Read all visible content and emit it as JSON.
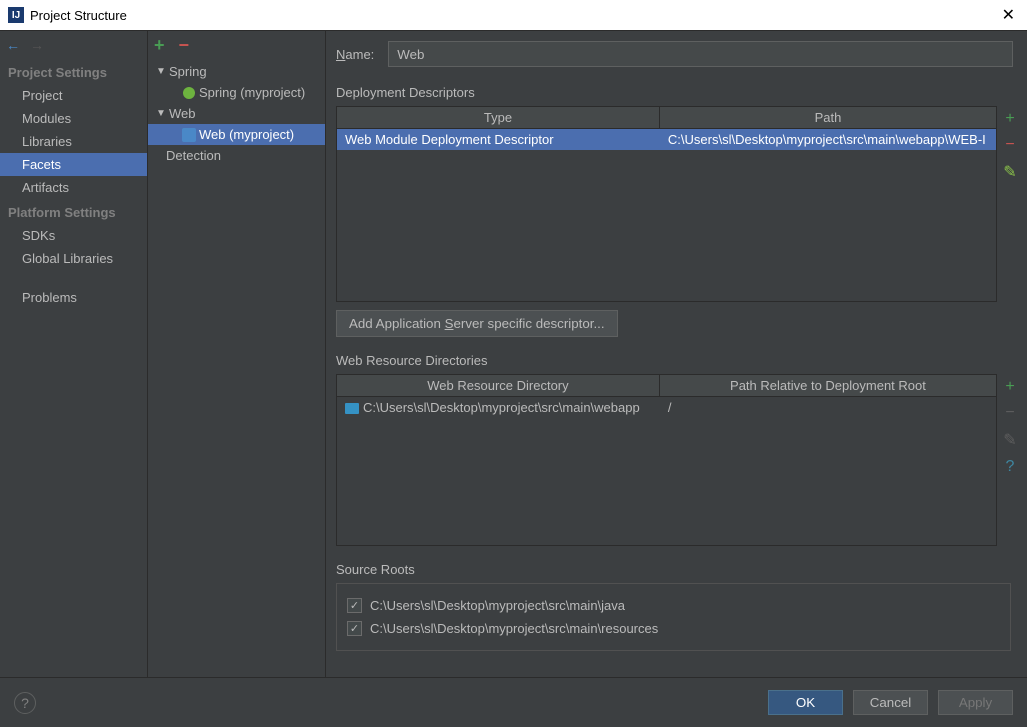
{
  "window": {
    "title": "Project Structure"
  },
  "sidebar": {
    "heading1": "Project Settings",
    "items1": [
      "Project",
      "Modules",
      "Libraries",
      "Facets",
      "Artifacts"
    ],
    "heading2": "Platform Settings",
    "items2": [
      "SDKs",
      "Global Libraries"
    ],
    "items3": [
      "Problems"
    ],
    "selected": "Facets"
  },
  "tree": {
    "spring": {
      "label": "Spring",
      "child": "Spring (myproject)"
    },
    "web": {
      "label": "Web",
      "child": "Web (myproject)"
    },
    "detection": "Detection"
  },
  "name": {
    "label": "Name:",
    "value": "Web"
  },
  "deploy": {
    "heading": "Deployment Descriptors",
    "cols": [
      "Type",
      "Path"
    ],
    "row": {
      "type": "Web Module Deployment Descriptor",
      "path": "C:\\Users\\sl\\Desktop\\myproject\\src\\main\\webapp\\WEB-I"
    },
    "button": "Add Application Server specific descriptor..."
  },
  "webres": {
    "heading": "Web Resource Directories",
    "cols": [
      "Web Resource Directory",
      "Path Relative to Deployment Root"
    ],
    "row": {
      "dir": "C:\\Users\\sl\\Desktop\\myproject\\src\\main\\webapp",
      "rel": "/"
    }
  },
  "roots": {
    "heading": "Source Roots",
    "items": [
      "C:\\Users\\sl\\Desktop\\myproject\\src\\main\\java",
      "C:\\Users\\sl\\Desktop\\myproject\\src\\main\\resources"
    ]
  },
  "footer": {
    "ok": "OK",
    "cancel": "Cancel",
    "apply": "Apply"
  }
}
